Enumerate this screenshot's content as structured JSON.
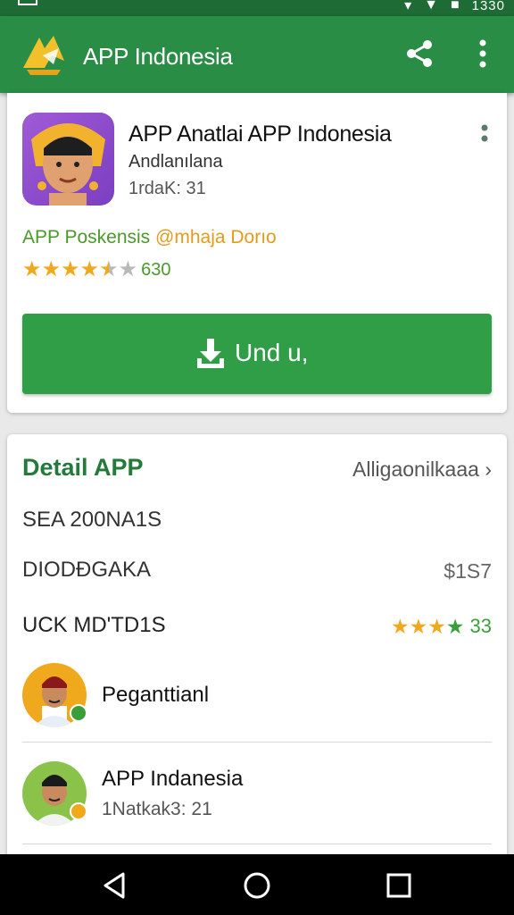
{
  "status_bar": {
    "time": "1330"
  },
  "app_bar": {
    "title": "APP Indonesia",
    "share_icon": "share-icon",
    "more_icon": "more-vert-icon"
  },
  "app_card": {
    "name": "APP Anatlai APP Indonesia",
    "developer": "Andlanılana",
    "size": "1rdaK: 31",
    "promo_prefix": "APP Poskensis ",
    "promo_highlight": "@mhaja Dorıo",
    "rating": {
      "stars": 4.5,
      "count": "630"
    },
    "install_label": "Und u,",
    "colors": {
      "primary": "#2a8d45",
      "button": "#2f9e46",
      "star": "#f0a81c"
    }
  },
  "detail": {
    "title": "Detail APP",
    "link": "Alligaonilkaaa",
    "rows": [
      {
        "label": "SEA 200NA1S"
      },
      {
        "label": "DIODĐGAKA",
        "value": "$1S7"
      },
      {
        "label": "UCK MD'TD1S",
        "rating_count": "33"
      }
    ],
    "developers": [
      {
        "name": "Peganttianl",
        "sub": ""
      },
      {
        "name": "APP Indanesia",
        "sub": "1Natkak3: 21"
      }
    ]
  }
}
